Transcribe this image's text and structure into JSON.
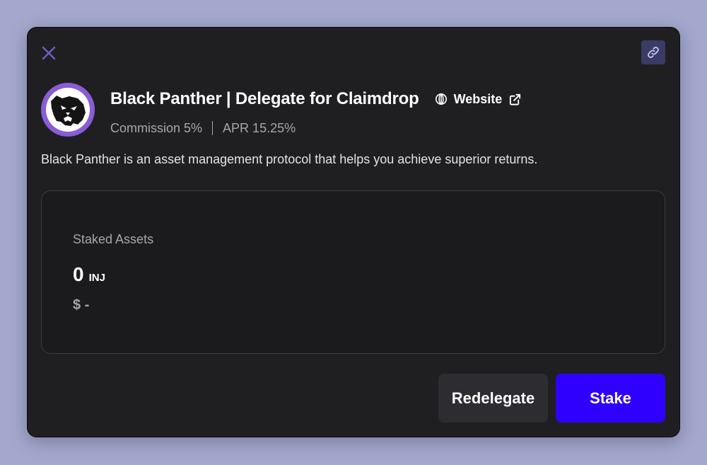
{
  "modal": {
    "close_icon": "close-icon",
    "share_icon": "link-icon",
    "colors": {
      "backdrop": "#a4a8cc",
      "surface": "#1f1f22",
      "accent": "#3000ff",
      "icon_accent": "#6b5fc4"
    }
  },
  "validator": {
    "name": "Black Panther | Delegate for Claimdrop",
    "avatar_icon": "panther-logo",
    "website_label": "Website",
    "commission": "Commission 5%",
    "apr": "APR 15.25%",
    "description": "Black Panther is an asset management protocol that helps you achieve superior returns."
  },
  "staked": {
    "label": "Staked Assets",
    "amount": "0",
    "token": "INJ",
    "usd": "$ -"
  },
  "actions": {
    "redelegate_label": "Redelegate",
    "stake_label": "Stake"
  }
}
